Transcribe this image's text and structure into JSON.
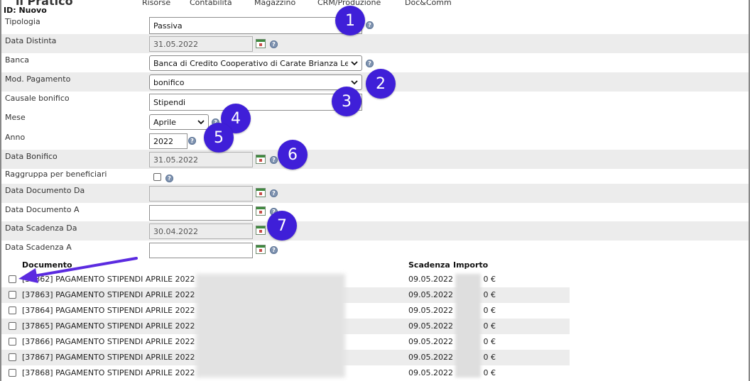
{
  "topnav": {
    "logo": "il Pratico",
    "items": [
      "Risorse",
      "Contabilità",
      "Magazzino",
      "CRM/Produzione",
      "Doc&Comm"
    ]
  },
  "id_line": "ID: Nuovo",
  "form": {
    "tipologia": {
      "label": "Tipologia",
      "value": "Passiva"
    },
    "data_distinta": {
      "label": "Data Distinta",
      "value": "31.05.2022"
    },
    "banca": {
      "label": "Banca",
      "value": "Banca di Credito Cooperativo di Carate Brianza Lec"
    },
    "mod_pagamento": {
      "label": "Mod. Pagamento",
      "value": "bonifico"
    },
    "causale_bonifico": {
      "label": "Causale bonifico",
      "value": "Stipendi"
    },
    "mese": {
      "label": "Mese",
      "value": "Aprile"
    },
    "anno": {
      "label": "Anno",
      "value": "2022"
    },
    "data_bonifico": {
      "label": "Data Bonifico",
      "value": "31.05.2022"
    },
    "raggruppa": {
      "label": "Raggruppa per beneficiari"
    },
    "data_documento_da": {
      "label": "Data Documento Da",
      "value": ""
    },
    "data_documento_a": {
      "label": "Data Documento A",
      "value": ""
    },
    "data_scadenza_da": {
      "label": "Data Scadenza Da",
      "value": "30.04.2022"
    },
    "data_scadenza_a": {
      "label": "Data Scadenza A",
      "value": ""
    }
  },
  "help_glyph": "?",
  "badges": [
    "1",
    "2",
    "3",
    "4",
    "5",
    "6",
    "7"
  ],
  "table": {
    "headers": {
      "documento": "Documento",
      "scadenza": "Scadenza",
      "importo": "Importo"
    },
    "rows": [
      {
        "doc": "[37862] PAGAMENTO STIPENDI APRILE 2022",
        "scadenza": "09.05.2022",
        "importo": "0 €"
      },
      {
        "doc": "[37863] PAGAMENTO STIPENDI APRILE 2022",
        "scadenza": "09.05.2022",
        "importo": "0 €"
      },
      {
        "doc": "[37864] PAGAMENTO STIPENDI APRILE 2022",
        "scadenza": "09.05.2022",
        "importo": "0 €"
      },
      {
        "doc": "[37865] PAGAMENTO STIPENDI APRILE 2022",
        "scadenza": "09.05.2022",
        "importo": "0 €"
      },
      {
        "doc": "[37866] PAGAMENTO STIPENDI APRILE 2022",
        "scadenza": "09.05.2022",
        "importo": "0 €"
      },
      {
        "doc": "[37867] PAGAMENTO STIPENDI APRILE 2022",
        "scadenza": "09.05.2022",
        "importo": "0 €"
      },
      {
        "doc": "[37868] PAGAMENTO STIPENDI APRILE 2022",
        "scadenza": "09.05.2022",
        "importo": "0 €"
      }
    ]
  },
  "colors": {
    "badge": "#3f1fd8",
    "arrow": "#5b2be0",
    "row_shade": "#ececec"
  }
}
